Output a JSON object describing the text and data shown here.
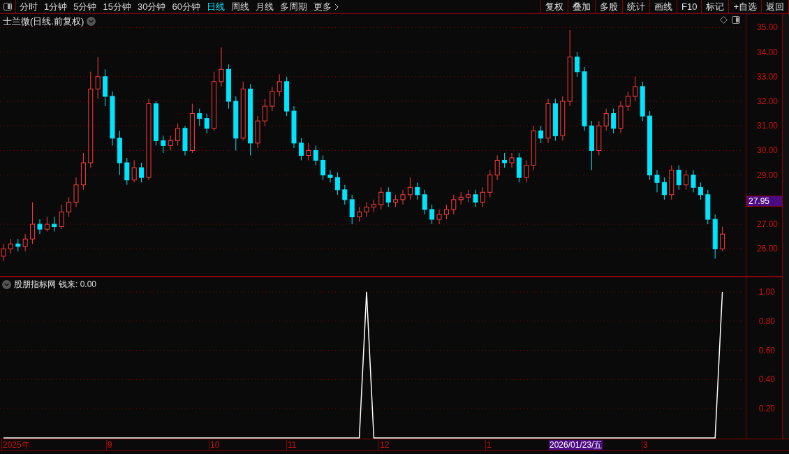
{
  "toolbar": {
    "periods": [
      {
        "label": "分时",
        "selected": false
      },
      {
        "label": "1分钟",
        "selected": false
      },
      {
        "label": "5分钟",
        "selected": false
      },
      {
        "label": "15分钟",
        "selected": false
      },
      {
        "label": "30分钟",
        "selected": false
      },
      {
        "label": "60分钟",
        "selected": false
      },
      {
        "label": "日线",
        "selected": true
      },
      {
        "label": "周线",
        "selected": false
      },
      {
        "label": "月线",
        "selected": false
      },
      {
        "label": "多周期",
        "selected": false
      },
      {
        "label": "更多",
        "selected": false
      }
    ],
    "buttons": [
      "复权",
      "叠加",
      "多股",
      "统计",
      "画线",
      "F10",
      "标记",
      "+自选",
      "返回"
    ]
  },
  "chart": {
    "title": "士兰微(日线.前复权)",
    "current_price": "27.95",
    "chart_data": {
      "type": "candlestick",
      "ylim": [
        24.9,
        35.55
      ],
      "grid": true,
      "yticks": [
        {
          "value": 35,
          "label": "35.00"
        },
        {
          "value": 34,
          "label": "34.00"
        },
        {
          "value": 33,
          "label": "33.00"
        },
        {
          "value": 32,
          "label": "32.00"
        },
        {
          "value": 31,
          "label": "31.00"
        },
        {
          "value": 30,
          "label": "30.00"
        },
        {
          "value": 29,
          "label": "29.00"
        },
        {
          "value": 27,
          "label": "27.00"
        },
        {
          "value": 26,
          "label": "26.00"
        }
      ],
      "ohlc": [
        [
          25.7,
          26.2,
          25.5,
          26.0
        ],
        [
          26.0,
          26.4,
          25.8,
          26.2
        ],
        [
          26.2,
          26.4,
          25.9,
          26.1
        ],
        [
          26.1,
          26.6,
          25.9,
          26.4
        ],
        [
          26.4,
          27.9,
          26.2,
          27.0
        ],
        [
          27.0,
          27.2,
          26.6,
          26.8
        ],
        [
          26.8,
          27.3,
          26.7,
          27.0
        ],
        [
          27.0,
          27.3,
          26.7,
          26.9
        ],
        [
          26.9,
          27.8,
          26.8,
          27.5
        ],
        [
          27.5,
          28.1,
          27.3,
          27.9
        ],
        [
          27.9,
          28.9,
          27.7,
          28.6
        ],
        [
          28.6,
          29.9,
          28.4,
          29.5
        ],
        [
          29.5,
          33.2,
          29.3,
          32.5
        ],
        [
          32.5,
          33.8,
          32.1,
          33.0
        ],
        [
          33.0,
          33.3,
          31.8,
          32.2
        ],
        [
          32.2,
          32.4,
          30.2,
          30.5
        ],
        [
          30.5,
          30.8,
          29.0,
          29.5
        ],
        [
          29.5,
          29.7,
          28.6,
          28.8
        ],
        [
          28.8,
          29.6,
          28.7,
          29.3
        ],
        [
          29.3,
          29.5,
          28.7,
          28.9
        ],
        [
          28.9,
          32.1,
          28.8,
          31.9
        ],
        [
          31.9,
          32.0,
          30.2,
          30.4
        ],
        [
          30.4,
          30.6,
          29.9,
          30.2
        ],
        [
          30.2,
          30.6,
          30.0,
          30.4
        ],
        [
          30.4,
          31.1,
          30.2,
          30.9
        ],
        [
          30.9,
          31.0,
          29.8,
          30.0
        ],
        [
          30.0,
          31.9,
          29.9,
          31.5
        ],
        [
          31.5,
          31.7,
          31.0,
          31.3
        ],
        [
          31.3,
          31.5,
          30.7,
          30.9
        ],
        [
          30.9,
          33.2,
          30.8,
          32.8
        ],
        [
          32.8,
          34.2,
          32.6,
          33.3
        ],
        [
          33.3,
          33.5,
          31.7,
          32.0
        ],
        [
          32.0,
          32.2,
          30.0,
          30.5
        ],
        [
          30.5,
          32.8,
          30.4,
          32.5
        ],
        [
          32.5,
          32.7,
          29.8,
          30.3
        ],
        [
          30.3,
          31.4,
          30.1,
          31.2
        ],
        [
          31.2,
          32.1,
          31.0,
          31.8
        ],
        [
          31.8,
          32.6,
          31.6,
          32.4
        ],
        [
          32.4,
          33.1,
          32.2,
          32.8
        ],
        [
          32.8,
          33.0,
          31.4,
          31.6
        ],
        [
          31.6,
          31.8,
          30.1,
          30.3
        ],
        [
          30.3,
          30.5,
          29.6,
          29.8
        ],
        [
          29.8,
          30.3,
          29.6,
          30.0
        ],
        [
          30.0,
          30.2,
          29.4,
          29.6
        ],
        [
          29.6,
          29.8,
          28.8,
          29.0
        ],
        [
          29.0,
          29.2,
          28.7,
          28.9
        ],
        [
          28.9,
          29.1,
          28.2,
          28.4
        ],
        [
          28.4,
          28.6,
          27.8,
          28.0
        ],
        [
          28.0,
          28.2,
          27.0,
          27.3
        ],
        [
          27.3,
          27.7,
          27.1,
          27.5
        ],
        [
          27.5,
          27.9,
          27.3,
          27.7
        ],
        [
          27.7,
          28.0,
          27.5,
          27.8
        ],
        [
          27.8,
          28.5,
          27.6,
          28.3
        ],
        [
          28.3,
          28.5,
          27.7,
          27.9
        ],
        [
          27.9,
          28.2,
          27.7,
          28.0
        ],
        [
          28.0,
          28.4,
          27.8,
          28.2
        ],
        [
          28.2,
          28.9,
          28.0,
          28.5
        ],
        [
          28.5,
          28.7,
          28.0,
          28.2
        ],
        [
          28.2,
          28.4,
          27.4,
          27.6
        ],
        [
          27.6,
          27.8,
          27.0,
          27.2
        ],
        [
          27.2,
          27.6,
          27.0,
          27.4
        ],
        [
          27.4,
          27.8,
          27.2,
          27.6
        ],
        [
          27.6,
          28.2,
          27.4,
          28.0
        ],
        [
          28.0,
          28.3,
          27.8,
          28.1
        ],
        [
          28.1,
          28.4,
          27.9,
          28.2
        ],
        [
          28.2,
          28.4,
          27.7,
          27.9
        ],
        [
          27.9,
          28.5,
          27.7,
          28.3
        ],
        [
          28.3,
          29.2,
          28.1,
          29.0
        ],
        [
          29.0,
          29.8,
          28.8,
          29.6
        ],
        [
          29.6,
          29.9,
          29.3,
          29.5
        ],
        [
          29.5,
          29.9,
          29.3,
          29.7
        ],
        [
          29.7,
          29.9,
          28.7,
          28.9
        ],
        [
          28.9,
          29.6,
          28.7,
          29.4
        ],
        [
          29.4,
          31.0,
          29.2,
          30.8
        ],
        [
          30.8,
          31.0,
          30.3,
          30.5
        ],
        [
          30.5,
          32.1,
          30.3,
          31.9
        ],
        [
          31.9,
          32.1,
          30.4,
          30.6
        ],
        [
          30.6,
          32.2,
          30.4,
          32.0
        ],
        [
          32.0,
          34.9,
          31.8,
          33.8
        ],
        [
          33.8,
          34.0,
          33.0,
          33.2
        ],
        [
          33.2,
          33.4,
          30.8,
          31.0
        ],
        [
          31.0,
          31.2,
          29.2,
          30.0
        ],
        [
          30.0,
          31.2,
          29.8,
          31.0
        ],
        [
          31.0,
          31.7,
          30.8,
          31.5
        ],
        [
          31.5,
          31.7,
          30.7,
          30.9
        ],
        [
          30.9,
          32.0,
          30.7,
          31.8
        ],
        [
          31.8,
          32.4,
          31.6,
          32.2
        ],
        [
          32.2,
          33.0,
          32.0,
          32.6
        ],
        [
          32.6,
          32.8,
          31.2,
          31.4
        ],
        [
          31.4,
          31.6,
          28.8,
          29.0
        ],
        [
          29.0,
          29.2,
          28.3,
          28.7
        ],
        [
          28.7,
          28.9,
          28.0,
          28.2
        ],
        [
          28.2,
          29.4,
          28.0,
          29.2
        ],
        [
          29.2,
          29.4,
          28.4,
          28.6
        ],
        [
          28.6,
          29.2,
          28.4,
          29.0
        ],
        [
          29.0,
          29.2,
          28.3,
          28.5
        ],
        [
          28.5,
          28.7,
          28.0,
          28.2
        ],
        [
          28.2,
          28.4,
          27.0,
          27.2
        ],
        [
          27.2,
          27.4,
          25.6,
          26.0
        ],
        [
          26.0,
          26.9,
          25.9,
          26.6
        ]
      ]
    }
  },
  "indicator": {
    "name": "股朋指标网",
    "reading": "钱来: 0.00",
    "chart_data": {
      "type": "line",
      "ylim": [
        0,
        1.1
      ],
      "grid": true,
      "yticks": [
        {
          "value": 0.2,
          "label": "0.20"
        },
        {
          "value": 0.4,
          "label": "0.40"
        },
        {
          "value": 0.6,
          "label": "0.60"
        },
        {
          "value": 0.8,
          "label": "0.80"
        },
        {
          "value": 1.0,
          "label": "1.00"
        }
      ],
      "series": [
        {
          "color": "#ffffff",
          "values": [
            0,
            0,
            0,
            0,
            0,
            0,
            0,
            0,
            0,
            0,
            0,
            0,
            0,
            0,
            0,
            0,
            0,
            0,
            0,
            0,
            0,
            0,
            0,
            0,
            0,
            0,
            0,
            0,
            0,
            0,
            0,
            0,
            0,
            0,
            0,
            0,
            0,
            0,
            0,
            0,
            0,
            0,
            0,
            0,
            0,
            0,
            0,
            0,
            0,
            0,
            1,
            0,
            0,
            0,
            0,
            0,
            0,
            0,
            0,
            0,
            0,
            0,
            0,
            0,
            0,
            0,
            0,
            0,
            0,
            0,
            0,
            0,
            0,
            0,
            0,
            0,
            0,
            0,
            0,
            0,
            0,
            0,
            0,
            0,
            0,
            0,
            0,
            0,
            0,
            0,
            0,
            0,
            0,
            0,
            0,
            0,
            0,
            0,
            0,
            1
          ]
        }
      ]
    }
  },
  "date_axis": {
    "labels": [
      "2025年",
      "9",
      "10",
      "11",
      "12",
      "1",
      "3"
    ],
    "cursor_date": "2026/01/23/五"
  }
}
